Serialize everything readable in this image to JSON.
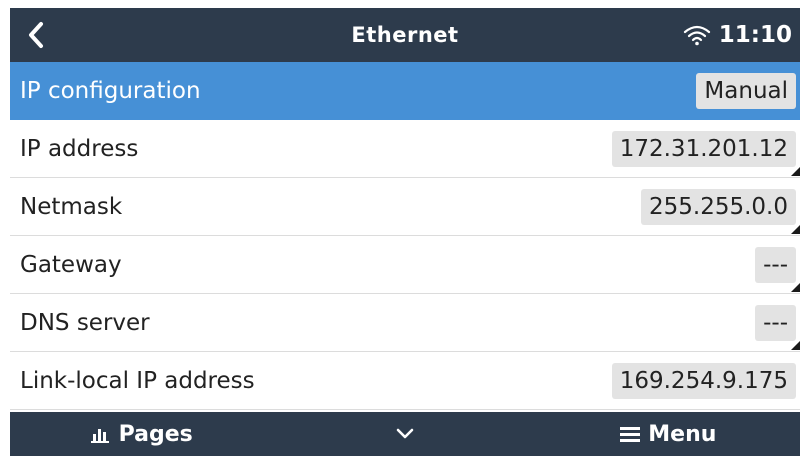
{
  "header": {
    "title": "Ethernet",
    "time": "11:10",
    "back_icon": "chevron-left-icon",
    "wifi_icon": "wifi-icon"
  },
  "rows": [
    {
      "label": "IP configuration",
      "value": "Manual",
      "selected": true
    },
    {
      "label": "IP address",
      "value": "172.31.201.12",
      "editable": true
    },
    {
      "label": "Netmask",
      "value": "255.255.0.0",
      "editable": true
    },
    {
      "label": "Gateway",
      "value": "---",
      "editable": true
    },
    {
      "label": "DNS server",
      "value": "---",
      "editable": true
    },
    {
      "label": "Link-local IP address",
      "value": "169.254.9.175"
    }
  ],
  "footer": {
    "pages_label": "Pages",
    "menu_label": "Menu",
    "pages_icon": "bar-chart-icon",
    "chevron_icon": "chevron-down-icon",
    "menu_icon": "hamburger-icon"
  },
  "colors": {
    "header_bg": "#2d3b4c",
    "selected_bg": "#4690d6",
    "value_bg": "#e3e3e3"
  }
}
